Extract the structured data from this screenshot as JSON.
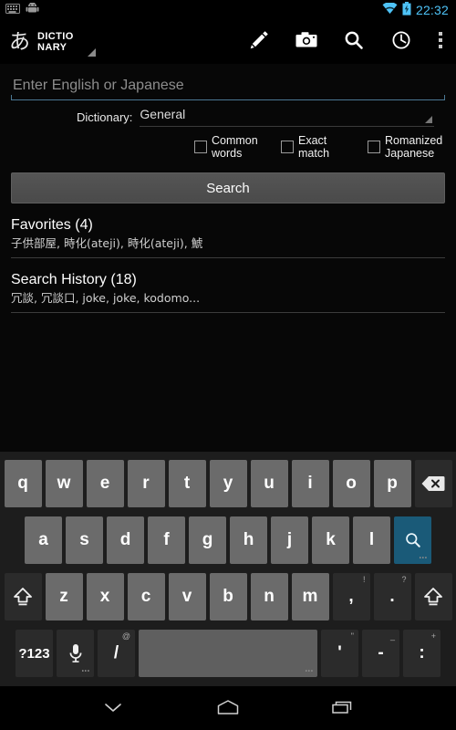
{
  "statusbar": {
    "clock": "22:32",
    "icons": [
      "keyboard-icon",
      "android-robot-icon",
      "wifi-icon",
      "battery-charging-icon"
    ]
  },
  "actionbar": {
    "brand_glyph": "あ",
    "brand_line1": "DICTIO",
    "brand_line2": "NARY",
    "actions": [
      {
        "name": "edit-icon",
        "label": "Edit"
      },
      {
        "name": "camera-icon",
        "label": "Camera"
      },
      {
        "name": "search-icon",
        "label": "Search"
      },
      {
        "name": "history-clock-icon",
        "label": "History"
      },
      {
        "name": "overflow-menu-icon",
        "label": "More options"
      }
    ]
  },
  "form": {
    "query_placeholder": "Enter English or Japanese",
    "query_value": "",
    "dictionary_label": "Dictionary:",
    "dictionary_value": "General",
    "dictionary_options": [
      "General"
    ],
    "checkboxes": [
      {
        "label": "Common words",
        "checked": false
      },
      {
        "label": "Exact match",
        "checked": false
      },
      {
        "label": "Romanized Japanese",
        "checked": false
      }
    ],
    "search_button": "Search"
  },
  "sections": [
    {
      "title": "Favorites (4)",
      "items": "子供部屋, 時化(ateji), 時化(ateji), 鯱"
    },
    {
      "title": "Search History (18)",
      "items": "冗談, 冗談口, joke, joke, kodomo..."
    }
  ],
  "keyboard": {
    "row1": [
      {
        "label": "q"
      },
      {
        "label": "w"
      },
      {
        "label": "e"
      },
      {
        "label": "r"
      },
      {
        "label": "t"
      },
      {
        "label": "y"
      },
      {
        "label": "u"
      },
      {
        "label": "i"
      },
      {
        "label": "o"
      },
      {
        "label": "p"
      }
    ],
    "backspace": {
      "name": "backspace-key",
      "label": "⌫"
    },
    "row2": [
      {
        "label": "a"
      },
      {
        "label": "s"
      },
      {
        "label": "d"
      },
      {
        "label": "f"
      },
      {
        "label": "g"
      },
      {
        "label": "h"
      },
      {
        "label": "j"
      },
      {
        "label": "k"
      },
      {
        "label": "l"
      }
    ],
    "enter": {
      "name": "search-enter-key",
      "label": "search-icon"
    },
    "row3": [
      {
        "label": "z"
      },
      {
        "label": "x"
      },
      {
        "label": "c"
      },
      {
        "label": "v"
      },
      {
        "label": "b"
      },
      {
        "label": "n"
      },
      {
        "label": "m"
      },
      {
        "label": ",",
        "sup": "!"
      },
      {
        "label": ".",
        "sup": "?"
      }
    ],
    "shift_left": {
      "name": "shift-key",
      "label": "⇧"
    },
    "shift_right": {
      "name": "shift-key",
      "label": "⇧"
    },
    "row4": {
      "symbols": "?123",
      "mic": "mic-icon",
      "slash": {
        "label": "/",
        "sup": "@"
      },
      "space": " ",
      "apostrophe": {
        "label": "'",
        "sup": "\""
      },
      "hyphen": {
        "label": "-",
        "sup": "_"
      },
      "colon": {
        "label": ":",
        "sup": "+"
      }
    }
  },
  "navbar": {
    "back": "keyboard-down-icon",
    "home": "home-icon",
    "recents": "recents-icon"
  },
  "colors": {
    "accent_blue": "#4ec3f7",
    "enter_key_blue": "#1a5a78",
    "input_underline": "#4b7894",
    "keyboard_bg": "#1d1d1d",
    "key_gray": "#6b6b6b"
  }
}
